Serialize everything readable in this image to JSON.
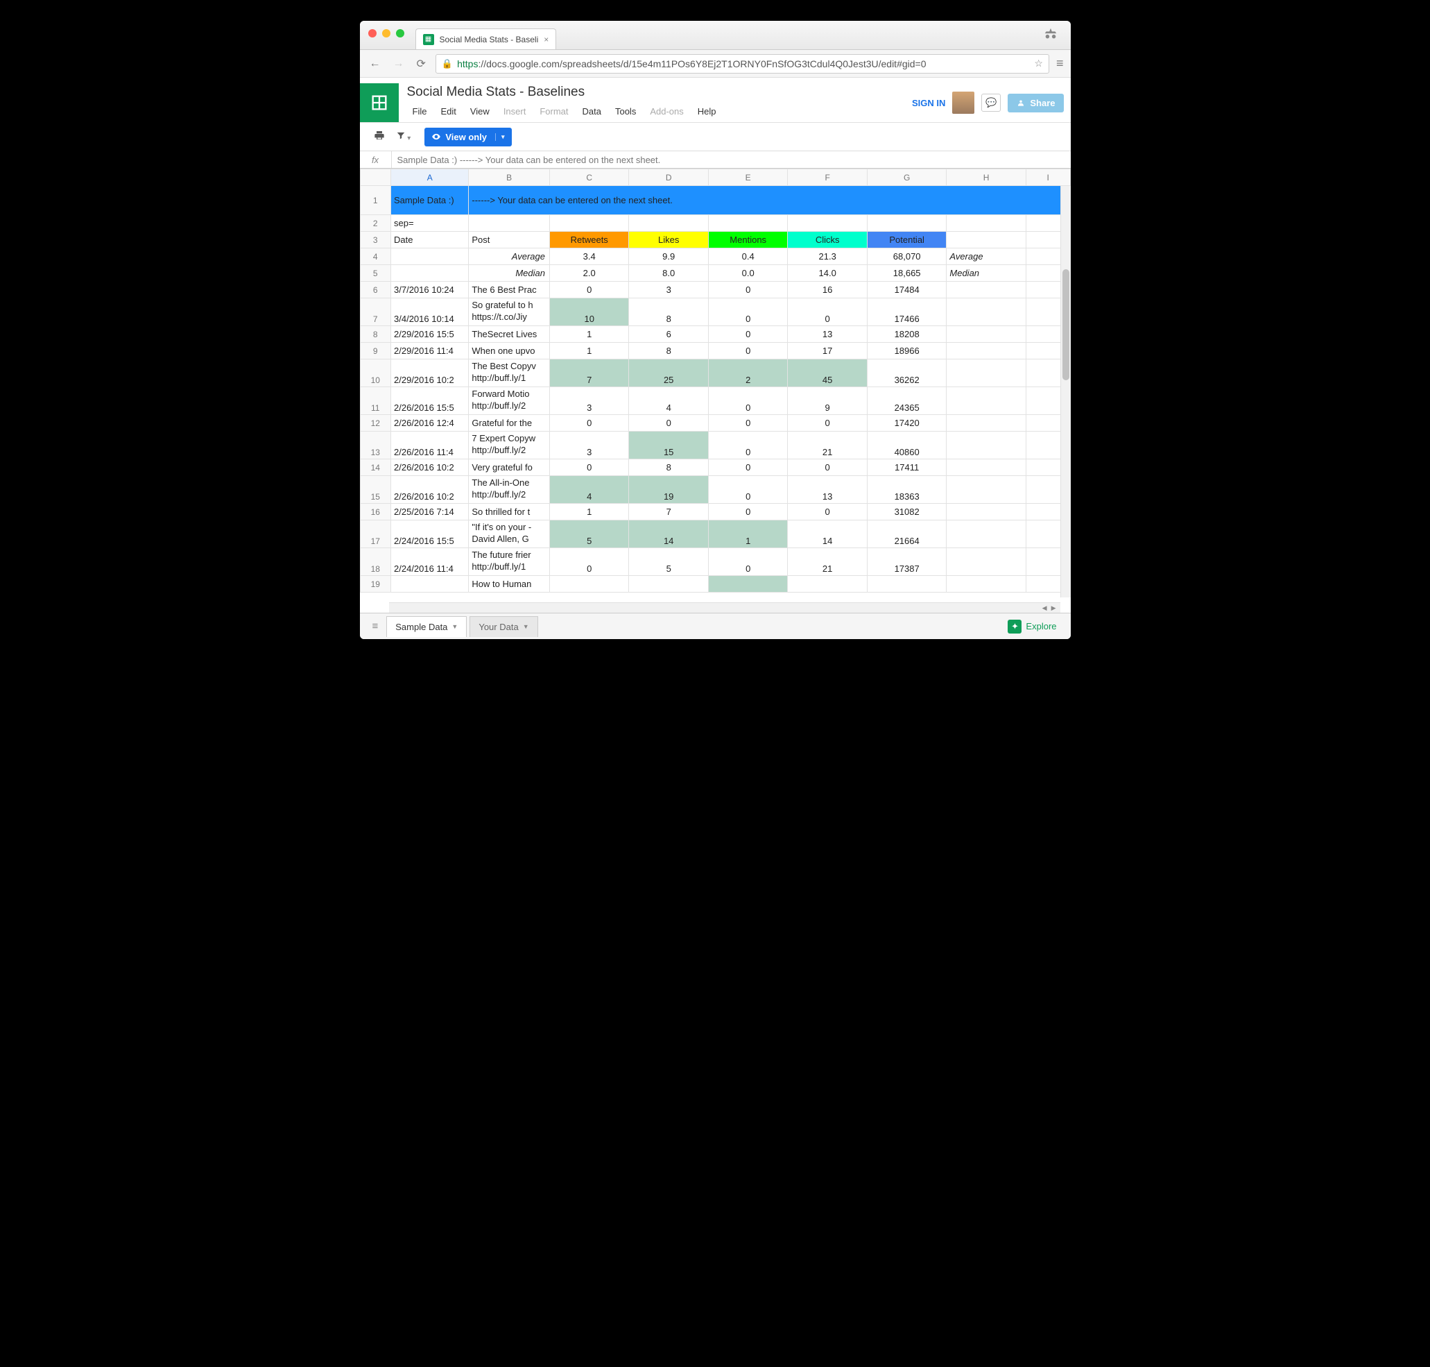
{
  "browser": {
    "tab_title": "Social Media Stats - Baseli",
    "url_https": "https",
    "url_rest": "://docs.google.com/spreadsheets/d/15e4m11POs6Y8Ej2T1ORNY0FnSfOG3tCdul4Q0Jest3U/edit#gid=0"
  },
  "doc": {
    "title": "Social Media Stats - Baselines",
    "menus": {
      "file": "File",
      "edit": "Edit",
      "view": "View",
      "insert": "Insert",
      "format": "Format",
      "data": "Data",
      "tools": "Tools",
      "addons": "Add-ons",
      "help": "Help"
    },
    "signin": "SIGN IN",
    "share": "Share",
    "viewonly": "View only"
  },
  "fx": "Sample Data :) ------> Your data can be entered on the next sheet.",
  "columns": [
    "A",
    "B",
    "C",
    "D",
    "E",
    "F",
    "G",
    "H",
    "I"
  ],
  "row1": {
    "a": "Sample Data :)",
    "rest": "------> Your data can be entered on the next sheet."
  },
  "row2": {
    "a": "sep="
  },
  "row3": {
    "date": "Date",
    "post": "Post",
    "retweets": "Retweets",
    "likes": "Likes",
    "mentions": "Mentions",
    "clicks": "Clicks",
    "potential": "Potential"
  },
  "row4": {
    "label": "Average",
    "retweets": "3.4",
    "likes": "9.9",
    "mentions": "0.4",
    "clicks": "21.3",
    "potential": "68,070",
    "h": "Average"
  },
  "row5": {
    "label": "Median",
    "retweets": "2.0",
    "likes": "8.0",
    "mentions": "0.0",
    "clicks": "14.0",
    "potential": "18,665",
    "h": "Median"
  },
  "rows": [
    {
      "n": 6,
      "date": "3/7/2016 10:24",
      "post": "The 6 Best Prac",
      "r": "0",
      "l": "3",
      "m": "0",
      "c": "16",
      "p": "17484"
    },
    {
      "n": 7,
      "date": "3/4/2016 10:14",
      "post": "So grateful to h https://t.co/Jiy",
      "r": "10",
      "l": "8",
      "m": "0",
      "c": "0",
      "p": "17466",
      "tall": true,
      "hl": [
        "r"
      ]
    },
    {
      "n": 8,
      "date": "2/29/2016 15:5",
      "post": "TheSecret Lives",
      "r": "1",
      "l": "6",
      "m": "0",
      "c": "13",
      "p": "18208"
    },
    {
      "n": 9,
      "date": "2/29/2016 11:4",
      "post": "When one upvo",
      "r": "1",
      "l": "8",
      "m": "0",
      "c": "17",
      "p": "18966"
    },
    {
      "n": 10,
      "date": "2/29/2016 10:2",
      "post": "The Best Copyv http://buff.ly/1",
      "r": "7",
      "l": "25",
      "m": "2",
      "c": "45",
      "p": "36262",
      "tall": true,
      "hl": [
        "r",
        "l",
        "m",
        "c"
      ]
    },
    {
      "n": 11,
      "date": "2/26/2016 15:5",
      "post": "Forward Motio http://buff.ly/2",
      "r": "3",
      "l": "4",
      "m": "0",
      "c": "9",
      "p": "24365",
      "tall": true
    },
    {
      "n": 12,
      "date": "2/26/2016 12:4",
      "post": "Grateful for the",
      "r": "0",
      "l": "0",
      "m": "0",
      "c": "0",
      "p": "17420"
    },
    {
      "n": 13,
      "date": "2/26/2016 11:4",
      "post": "7 Expert Copyw http://buff.ly/2",
      "r": "3",
      "l": "15",
      "m": "0",
      "c": "21",
      "p": "40860",
      "tall": true,
      "hl": [
        "l"
      ]
    },
    {
      "n": 14,
      "date": "2/26/2016 10:2",
      "post": "Very grateful fo",
      "r": "0",
      "l": "8",
      "m": "0",
      "c": "0",
      "p": "17411"
    },
    {
      "n": 15,
      "date": "2/26/2016 10:2",
      "post": "The All-in-One http://buff.ly/2",
      "r": "4",
      "l": "19",
      "m": "0",
      "c": "13",
      "p": "18363",
      "tall": true,
      "hl": [
        "r",
        "l"
      ]
    },
    {
      "n": 16,
      "date": "2/25/2016 7:14",
      "post": "So thrilled for t",
      "r": "1",
      "l": "7",
      "m": "0",
      "c": "0",
      "p": "31082"
    },
    {
      "n": 17,
      "date": "2/24/2016 15:5",
      "post": "\"If it's on your - David Allen, G",
      "r": "5",
      "l": "14",
      "m": "1",
      "c": "14",
      "p": "21664",
      "tall": true,
      "hl": [
        "r",
        "l",
        "m"
      ]
    },
    {
      "n": 18,
      "date": "2/24/2016 11:4",
      "post": "The future frier http://buff.ly/1",
      "r": "0",
      "l": "5",
      "m": "0",
      "c": "21",
      "p": "17387",
      "tall": true
    },
    {
      "n": 19,
      "date": "",
      "post": "How to Human",
      "r": "",
      "l": "",
      "m": "",
      "c": "",
      "p": "",
      "hl": [
        "m"
      ]
    }
  ],
  "sheets": {
    "active": "Sample Data",
    "other": "Your Data"
  },
  "explore": "Explore"
}
